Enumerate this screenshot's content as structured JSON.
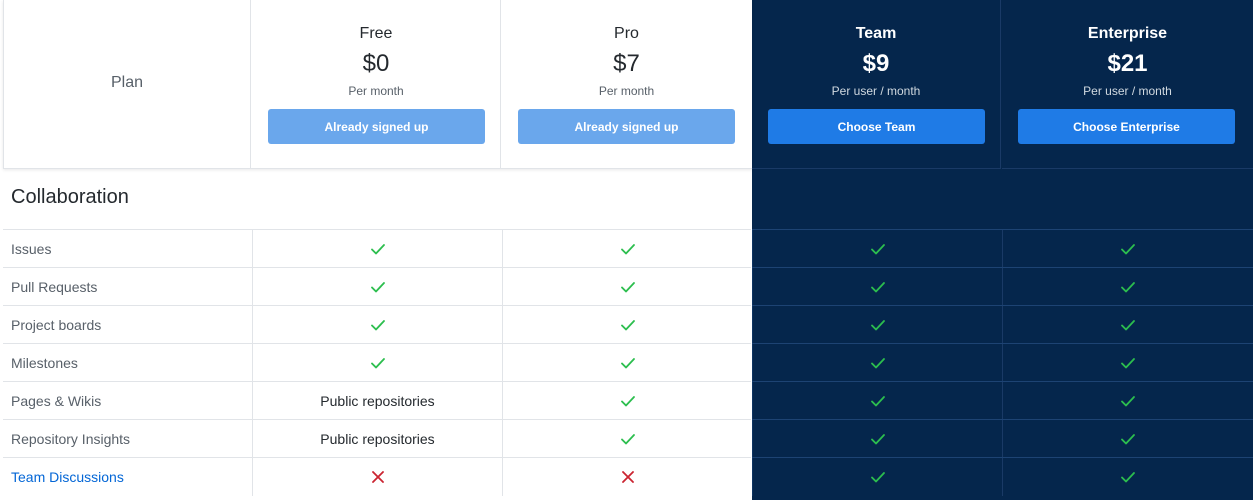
{
  "header": {
    "plan_label": "Plan",
    "tiers": [
      {
        "name": "Free",
        "price": "$0",
        "per": "Per month",
        "button": "Already signed up"
      },
      {
        "name": "Pro",
        "price": "$7",
        "per": "Per month",
        "button": "Already signed up"
      },
      {
        "name": "Team",
        "price": "$9",
        "per": "Per user / month",
        "button": "Choose Team"
      },
      {
        "name": "Enterprise",
        "price": "$21",
        "per": "Per user / month",
        "button": "Choose Enterprise"
      }
    ]
  },
  "section": {
    "title": "Collaboration"
  },
  "rows": [
    {
      "label": "Issues",
      "cells": [
        "check",
        "check",
        "check",
        "check"
      ]
    },
    {
      "label": "Pull Requests",
      "cells": [
        "check",
        "check",
        "check",
        "check"
      ]
    },
    {
      "label": "Project boards",
      "cells": [
        "check",
        "check",
        "check",
        "check"
      ]
    },
    {
      "label": "Milestones",
      "cells": [
        "check",
        "check",
        "check",
        "check"
      ]
    },
    {
      "label": "Pages & Wikis",
      "cells": [
        "Public repositories",
        "check",
        "check",
        "check"
      ]
    },
    {
      "label": "Repository Insights",
      "cells": [
        "Public repositories",
        "check",
        "check",
        "check"
      ]
    },
    {
      "label": "Team Discussions",
      "cells": [
        "cross",
        "cross",
        "check",
        "check"
      ]
    }
  ],
  "colors": {
    "dark_bg": "#05264c",
    "check": "#2cbe4e",
    "cross": "#cb2431",
    "primary_button": "#1f7be6",
    "disabled_button": "#6aa7ec",
    "link": "#0366d6"
  },
  "icons": {
    "check": "check-icon",
    "cross": "x-icon"
  }
}
